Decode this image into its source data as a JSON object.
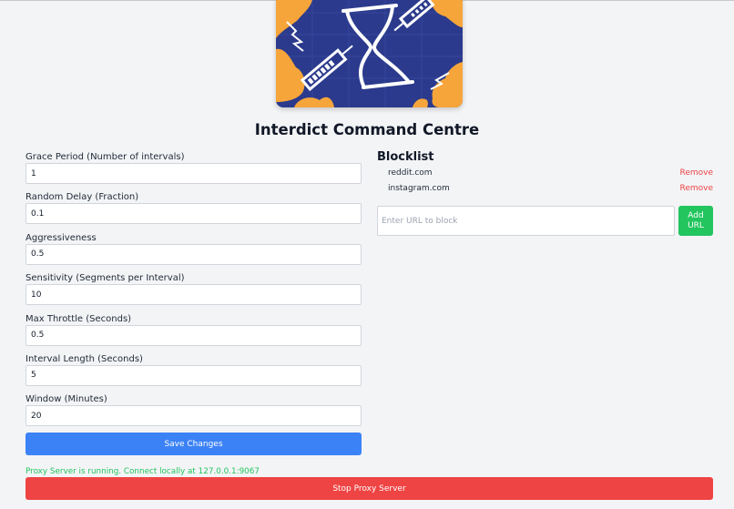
{
  "title": "Interdict Command Centre",
  "settings": [
    {
      "label": "Grace Period (Number of intervals)",
      "value": "1"
    },
    {
      "label": "Random Delay (Fraction)",
      "value": "0.1"
    },
    {
      "label": "Aggressiveness",
      "value": "0.5"
    },
    {
      "label": "Sensitivity (Segments per Interval)",
      "value": "10"
    },
    {
      "label": "Max Throttle (Seconds)",
      "value": "0.5"
    },
    {
      "label": "Interval Length (Seconds)",
      "value": "5"
    },
    {
      "label": "Window (Minutes)",
      "value": "20"
    }
  ],
  "save_label": "Save Changes",
  "status_text": "Proxy Server is running. Connect locally at 127.0.0.1:9067",
  "stop_label": "Stop Proxy Server",
  "blocklist": {
    "title": "Blocklist",
    "items": [
      {
        "url": "reddit.com",
        "remove_label": "Remove"
      },
      {
        "url": "instagram.com",
        "remove_label": "Remove"
      }
    ],
    "input_placeholder": "Enter URL to block",
    "add_label": "Add\nURL"
  },
  "colors": {
    "background": "#f3f4f6",
    "primary": "#3b82f6",
    "success": "#22c55e",
    "danger": "#ef4444",
    "logo_navy": "#2b3a8c",
    "logo_orange": "#f6a53a"
  },
  "icons": [
    "hourglass-logo-icon"
  ]
}
